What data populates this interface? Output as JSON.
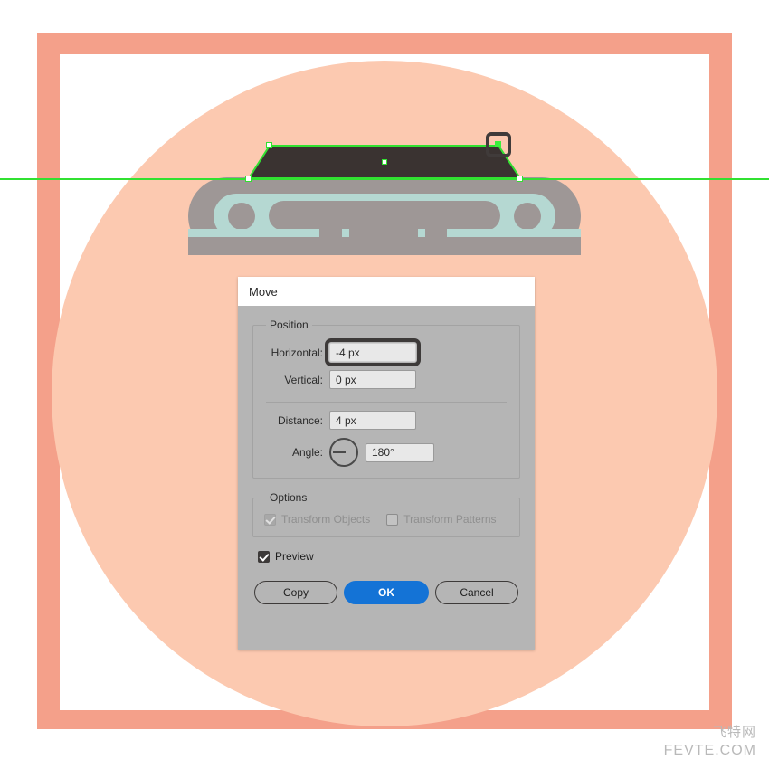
{
  "canvas": {
    "frame_color": "#f4a08a",
    "circle_color": "#fcc9b0",
    "guide_color": "#31e131",
    "shape_fill": "#3a3331",
    "illustration": {
      "outer_color": "#9e9796",
      "inner_color": "#b5d8d2"
    }
  },
  "selection": {
    "anchor_color": "#31e131",
    "selected_anchor_color": "#3cf03c",
    "cursor_box_color": "#403b3a"
  },
  "dialog": {
    "title": "Move",
    "position_group": {
      "legend": "Position",
      "fields": [
        {
          "label": "Horizontal:",
          "value": "-4 px",
          "focused": true
        },
        {
          "label": "Vertical:",
          "value": "0 px",
          "focused": false
        }
      ],
      "distance": {
        "label": "Distance:",
        "value": "4 px"
      },
      "angle": {
        "label": "Angle:",
        "value": "180°",
        "degrees": 180
      }
    },
    "options_group": {
      "legend": "Options",
      "checkboxes": [
        {
          "label": "Transform Objects",
          "checked": true,
          "disabled": true
        },
        {
          "label": "Transform Patterns",
          "checked": false,
          "disabled": true
        }
      ]
    },
    "preview": {
      "label": "Preview",
      "checked": true
    },
    "buttons": {
      "copy": "Copy",
      "ok": "OK",
      "cancel": "Cancel",
      "primary_color": "#1473d6"
    }
  },
  "watermark": {
    "cn": "飞特网",
    "en": "FEVTE.COM"
  }
}
